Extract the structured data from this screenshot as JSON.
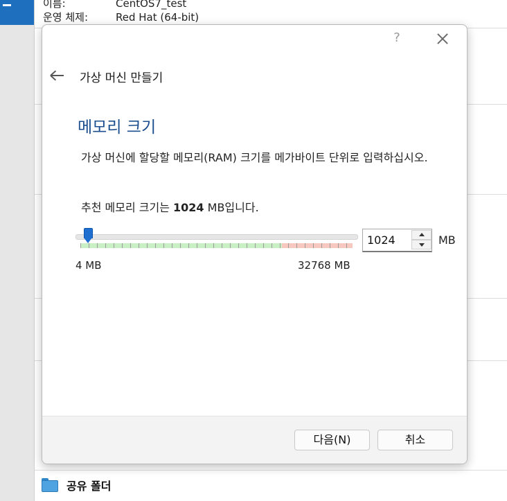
{
  "background": {
    "name_label": "이름:",
    "name_value": "CentOS7_test",
    "os_label": "운영 체제:",
    "os_value": "Red Hat (64-bit)",
    "shared_folder_label": "공유 폴더"
  },
  "dialog": {
    "help_label": "?",
    "wizard_title": "가상 머신 만들기",
    "page_title": "메모리 크기",
    "description": "가상 머신에 할당할 메모리(RAM) 크기를 메가바이트 단위로 입력하십시오.",
    "recommend_prefix": "추천 메모리 크기는 ",
    "recommend_value": "1024",
    "recommend_suffix": " MB입니다.",
    "slider": {
      "min_label": "4 MB",
      "max_label": "32768 MB",
      "value_mb": 1024,
      "min_mb": 4,
      "max_mb": 32768
    },
    "memory_value": "1024",
    "unit_label": "MB",
    "buttons": {
      "next": "다음(N)",
      "cancel": "취소"
    }
  }
}
